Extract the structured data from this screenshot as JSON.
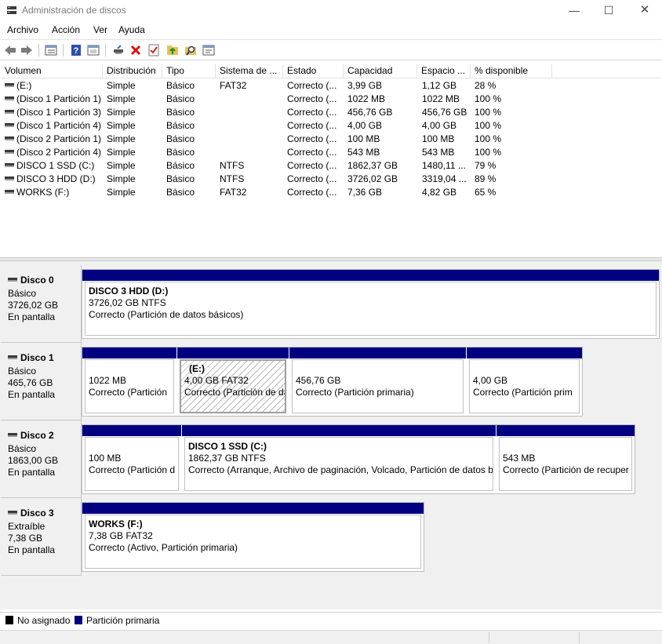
{
  "window": {
    "title": "Administración de discos",
    "min_glyph": "—",
    "max_glyph": "☐",
    "close_glyph": "✕"
  },
  "menu": [
    "Archivo",
    "Acción",
    "Ver",
    "Ayuda"
  ],
  "toolbar_icons": [
    "back-icon",
    "forward-icon",
    "disk-list-icon",
    "help-icon",
    "properties-icon",
    "connect-drive-icon",
    "delete-icon",
    "check-icon",
    "up-folder-icon",
    "search-icon",
    "console-icon"
  ],
  "columns": [
    "Volumen",
    "Distribución",
    "Tipo",
    "Sistema de ...",
    "Estado",
    "Capacidad",
    "Espacio ...",
    "% disponible"
  ],
  "volumes": [
    [
      "(E:)",
      "Simple",
      "Básico",
      "FAT32",
      "Correcto (...",
      "3,99 GB",
      "1,12 GB",
      "28 %"
    ],
    [
      "(Disco 1 Partición 1)",
      "Simple",
      "Básico",
      "",
      "Correcto (...",
      "1022 MB",
      "1022 MB",
      "100 %"
    ],
    [
      "(Disco 1 Partición 3)",
      "Simple",
      "Básico",
      "",
      "Correcto (...",
      "456,76 GB",
      "456,76 GB",
      "100 %"
    ],
    [
      "(Disco 1 Partición 4)",
      "Simple",
      "Básico",
      "",
      "Correcto (...",
      "4,00 GB",
      "4,00 GB",
      "100 %"
    ],
    [
      "(Disco 2 Partición 1)",
      "Simple",
      "Básico",
      "",
      "Correcto (...",
      "100 MB",
      "100 MB",
      "100 %"
    ],
    [
      "(Disco 2 Partición 4)",
      "Simple",
      "Básico",
      "",
      "Correcto (...",
      "543 MB",
      "543 MB",
      "100 %"
    ],
    [
      "DISCO 1 SSD (C:)",
      "Simple",
      "Básico",
      "NTFS",
      "Correcto (...",
      "1862,37 GB",
      "1480,11 ...",
      "79 %"
    ],
    [
      "DISCO 3 HDD (D:)",
      "Simple",
      "Básico",
      "NTFS",
      "Correcto (...",
      "3726,02 GB",
      "3319,04 ...",
      "89 %"
    ],
    [
      "WORKS (F:)",
      "Simple",
      "Básico",
      "FAT32",
      "Correcto (...",
      "7,36 GB",
      "4,82 GB",
      "65 %"
    ]
  ],
  "disks": [
    {
      "name": "Disco 0",
      "type": "Básico",
      "size": "3726,02 GB",
      "status": "En pantalla",
      "partitions": [
        {
          "title": "DISCO 3 HDD  (D:)",
          "line2": "3726,02 GB NTFS",
          "line3": "Correcto (Partición de datos básicos)"
        }
      ]
    },
    {
      "name": "Disco 1",
      "type": "Básico",
      "size": "465,76 GB",
      "status": "En pantalla",
      "partitions": [
        {
          "title": "",
          "line2": "1022 MB",
          "line3": "Correcto (Partición"
        },
        {
          "title": "(E:)",
          "line2": "4,00 GB FAT32",
          "line3": "Correcto (Partición de da"
        },
        {
          "title": "",
          "line2": "456,76 GB",
          "line3": "Correcto (Partición primaria)"
        },
        {
          "title": "",
          "line2": "4,00 GB",
          "line3": "Correcto (Partición prim"
        }
      ]
    },
    {
      "name": "Disco 2",
      "type": "Básico",
      "size": "1863,00 GB",
      "status": "En pantalla",
      "partitions": [
        {
          "title": "",
          "line2": "100 MB",
          "line3": "Correcto (Partición d"
        },
        {
          "title": "DISCO 1 SSD  (C:)",
          "line2": "1862,37 GB NTFS",
          "line3": "Correcto (Arranque, Archivo de paginación, Volcado, Partición de datos b"
        },
        {
          "title": "",
          "line2": "543 MB",
          "line3": "Correcto (Partición de recuper"
        }
      ]
    },
    {
      "name": "Disco 3",
      "type": "Extraíble",
      "size": "7,38 GB",
      "status": "En pantalla",
      "partitions": [
        {
          "title": "WORKS  (F:)",
          "line2": "7,38 GB FAT32",
          "line3": "Correcto (Activo, Partición primaria)"
        }
      ]
    }
  ],
  "legend": [
    {
      "label": "No asignado",
      "color": "#000000"
    },
    {
      "label": "Partición primaria",
      "color": "#000080"
    }
  ]
}
